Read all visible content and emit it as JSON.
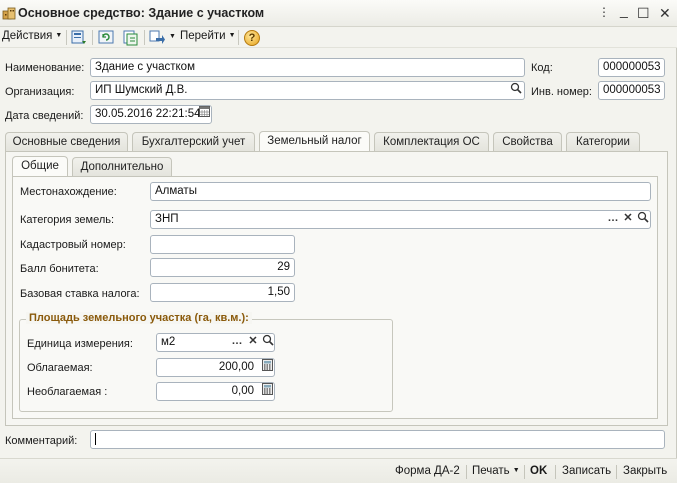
{
  "window": {
    "title": "Основное средство: Здание с участком",
    "controls": [
      "⋮",
      "_",
      "☐",
      "✕"
    ]
  },
  "toolbar": {
    "actions_label": "Действия",
    "goto_label": "Перейти",
    "help_label": "?"
  },
  "header": {
    "name_label": "Наименование:",
    "name_value": "Здание с участком",
    "code_label": "Код:",
    "code_value": "000000053",
    "org_label": "Организация:",
    "org_value": "ИП Шумский Д.В.",
    "inv_label": "Инв. номер:",
    "inv_value": "000000053",
    "date_label": "Дата сведений:",
    "date_value": "30.05.2016 22:21:54"
  },
  "tabs": [
    {
      "label": "Основные сведения"
    },
    {
      "label": "Бухгалтерский учет"
    },
    {
      "label": "Земельный налог"
    },
    {
      "label": "Комплектация ОС"
    },
    {
      "label": "Свойства"
    },
    {
      "label": "Категории"
    }
  ],
  "active_tab": "Земельный налог",
  "subtabs": [
    {
      "label": "Общие"
    },
    {
      "label": "Дополнительно"
    }
  ],
  "land": {
    "location_label": "Местонахождение:",
    "location_value": "Алматы",
    "category_label": "Категория земель:",
    "category_value": "ЗНП",
    "cadastral_label": "Кадастровый номер:",
    "cadastral_value": "",
    "bonitet_label": "Балл бонитета:",
    "bonitet_value": "29",
    "rate_label": "Базовая ставка налога:",
    "rate_value": "1,50"
  },
  "area": {
    "title": "Площадь земельного участка (га, кв.м.):",
    "unit_label": "Единица измерения:",
    "unit_value": "м2",
    "taxable_label": "Облагаемая:",
    "taxable_value": "200,00",
    "nontaxable_label": "Необлагаемая :",
    "nontaxable_value": "0,00"
  },
  "comment": {
    "label": "Комментарий:",
    "value": ""
  },
  "bottom": {
    "form_label": "Форма ДА-2",
    "print_label": "Печать",
    "ok_label": "OK",
    "save_label": "Записать",
    "close_label": "Закрыть"
  },
  "colors": {
    "group_title": "#8a5a0b",
    "window_bg": "#f3f3ee",
    "field_border": "#a9b3bd"
  }
}
